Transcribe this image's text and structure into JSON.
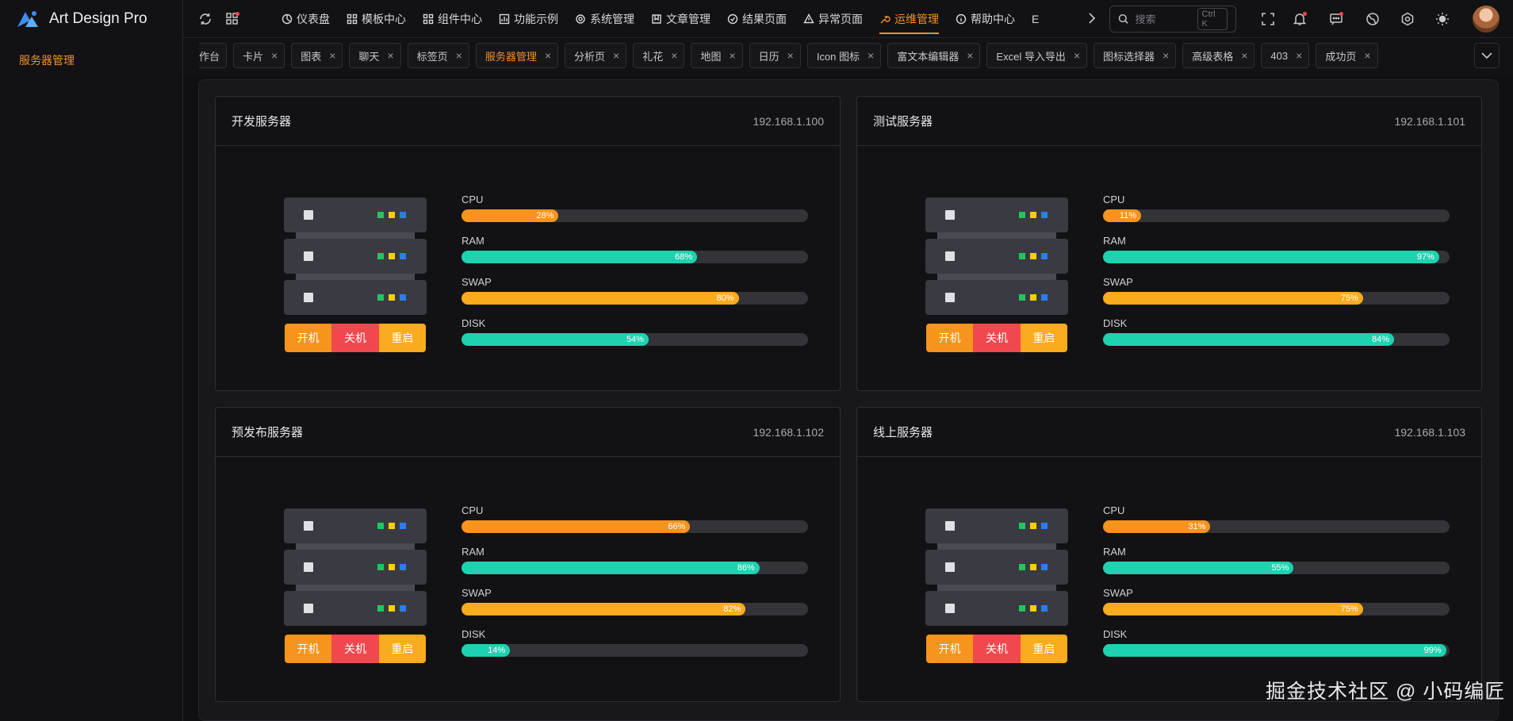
{
  "app": {
    "title": "Art Design Pro"
  },
  "sidebar": {
    "items": [
      {
        "label": "服务器管理",
        "active": true
      }
    ]
  },
  "header": {
    "nav": [
      {
        "label": "仪表盘",
        "icon": "dashboard-icon"
      },
      {
        "label": "模板中心",
        "icon": "grid-icon"
      },
      {
        "label": "组件中心",
        "icon": "grid-icon"
      },
      {
        "label": "功能示例",
        "icon": "chart-icon"
      },
      {
        "label": "系统管理",
        "icon": "gear-icon"
      },
      {
        "label": "文章管理",
        "icon": "book-icon"
      },
      {
        "label": "结果页面",
        "icon": "check-circle-icon"
      },
      {
        "label": "异常页面",
        "icon": "warning-icon"
      },
      {
        "label": "运维管理",
        "icon": "wrench-icon",
        "active": true
      },
      {
        "label": "帮助中心",
        "icon": "info-icon"
      }
    ],
    "nav_overflow": "E",
    "search": {
      "placeholder": "搜索",
      "shortcut": "Ctrl K"
    }
  },
  "tabs": [
    {
      "label": "工作台"
    },
    {
      "label": "卡片"
    },
    {
      "label": "图表"
    },
    {
      "label": "聊天"
    },
    {
      "label": "标签页"
    },
    {
      "label": "服务器管理",
      "active": true
    },
    {
      "label": "分析页"
    },
    {
      "label": "礼花"
    },
    {
      "label": "地图"
    },
    {
      "label": "日历"
    },
    {
      "label": "Icon 图标"
    },
    {
      "label": "富文本编辑器"
    },
    {
      "label": "Excel 导入导出"
    },
    {
      "label": "图标选择器"
    },
    {
      "label": "高级表格"
    },
    {
      "label": "403"
    },
    {
      "label": "成功页"
    }
  ],
  "colors": {
    "accent": "#f0902a",
    "cpu": "#f7941d",
    "ram": "#1ed2b0",
    "swap": "#fbab1e",
    "disk": "#1ed2b0",
    "btn_on": "#f7941d",
    "btn_off": "#f0484e",
    "btn_restart": "#fbab1e"
  },
  "server_buttons": {
    "on": "开机",
    "off": "关机",
    "restart": "重启"
  },
  "servers": [
    {
      "name": "开发服务器",
      "ip": "192.168.1.100",
      "metrics": [
        {
          "label": "CPU",
          "value": 28,
          "text": "28%"
        },
        {
          "label": "RAM",
          "value": 68,
          "text": "68%"
        },
        {
          "label": "SWAP",
          "value": 80,
          "text": "80%"
        },
        {
          "label": "DISK",
          "value": 54,
          "text": "54%"
        }
      ]
    },
    {
      "name": "测试服务器",
      "ip": "192.168.1.101",
      "metrics": [
        {
          "label": "CPU",
          "value": 11,
          "text": "11%"
        },
        {
          "label": "RAM",
          "value": 97,
          "text": "97%"
        },
        {
          "label": "SWAP",
          "value": 75,
          "text": "75%"
        },
        {
          "label": "DISK",
          "value": 84,
          "text": "84%"
        }
      ]
    },
    {
      "name": "预发布服务器",
      "ip": "192.168.1.102",
      "metrics": [
        {
          "label": "CPU",
          "value": 66,
          "text": "66%"
        },
        {
          "label": "RAM",
          "value": 86,
          "text": "86%"
        },
        {
          "label": "SWAP",
          "value": 82,
          "text": "82%"
        },
        {
          "label": "DISK",
          "value": 14,
          "text": "14%"
        }
      ]
    },
    {
      "name": "线上服务器",
      "ip": "192.168.1.103",
      "metrics": [
        {
          "label": "CPU",
          "value": 31,
          "text": "31%"
        },
        {
          "label": "RAM",
          "value": 55,
          "text": "55%"
        },
        {
          "label": "SWAP",
          "value": 75,
          "text": "75%"
        },
        {
          "label": "DISK",
          "value": 99,
          "text": "99%"
        }
      ]
    }
  ],
  "watermark": "掘金技术社区 @ 小码编匠"
}
